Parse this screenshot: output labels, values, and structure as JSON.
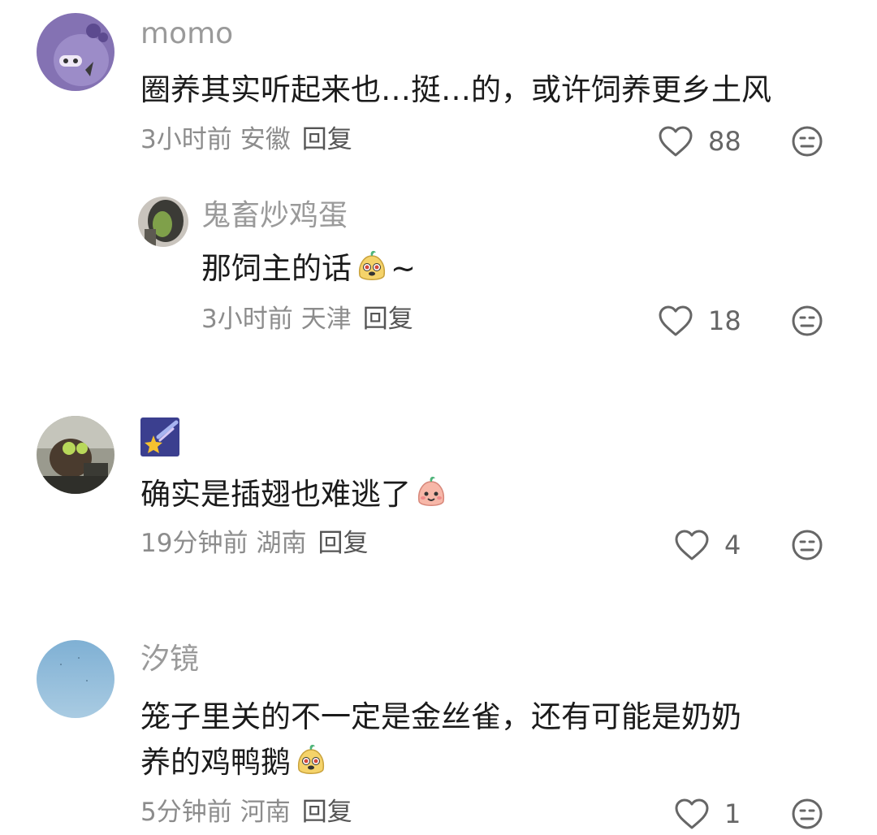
{
  "comments": [
    {
      "username": "momo",
      "text": "圈养其实听起来也…挺…的，或许饲养更乡土风",
      "time": "3小时前",
      "location": "安徽",
      "reply_label": "回复",
      "likes": "88",
      "replies": [
        {
          "username": "鬼畜炒鸡蛋",
          "text": "那饲主的话",
          "text_suffix": "~",
          "time": "3小时前",
          "location": "天津",
          "reply_label": "回复",
          "likes": "18"
        }
      ]
    },
    {
      "username_icon": "shooting-star-emoji",
      "text": "确实是插翅也难逃了",
      "time": "19分钟前",
      "location": "湖南",
      "reply_label": "回复",
      "likes": "4"
    },
    {
      "username": "汐镜",
      "text_line1": "笼子里关的不一定是金丝雀，还有可能是奶奶",
      "text_line2": "养的鸡鸭鹅",
      "time": "5分钟前",
      "location": "河南",
      "reply_label": "回复",
      "likes": "1"
    }
  ],
  "colors": {
    "username": "#9a9a9a",
    "text": "#1b1b1b",
    "meta": "#8c8c8c",
    "icon": "#666666"
  }
}
